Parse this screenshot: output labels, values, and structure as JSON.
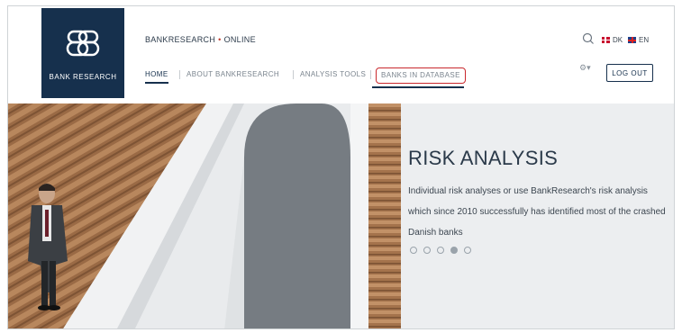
{
  "header": {
    "logo_text": "BANK RESEARCH",
    "brand": "BANKRESEARCH",
    "brand_separator": "•",
    "brand_suffix": "ONLINE",
    "nav": [
      {
        "label": "HOME",
        "active": true
      },
      {
        "label": "ABOUT BANKRESEARCH",
        "active": false
      },
      {
        "label": "ANALYSIS TOOLS",
        "active": false
      },
      {
        "label": "BANKS IN DATABASE",
        "active": false,
        "highlighted": true
      }
    ],
    "languages": [
      {
        "code": "DK",
        "flag": "flag-dk-icon"
      },
      {
        "code": "EN",
        "flag": "flag-en-icon"
      }
    ],
    "logout_label": "LOG OUT",
    "settings_icon": "gear-icon",
    "search_icon": "search-icon"
  },
  "hero": {
    "title": "RISK ANALYSIS",
    "text": "Individual risk analyses or use BankResearch's risk analysis which since 2010 successfully has identified most of the crashed Danish banks",
    "slides": 5,
    "active_slide": 4
  },
  "colors": {
    "brand_navy": "#16304d",
    "highlight_red": "#c9282d"
  }
}
